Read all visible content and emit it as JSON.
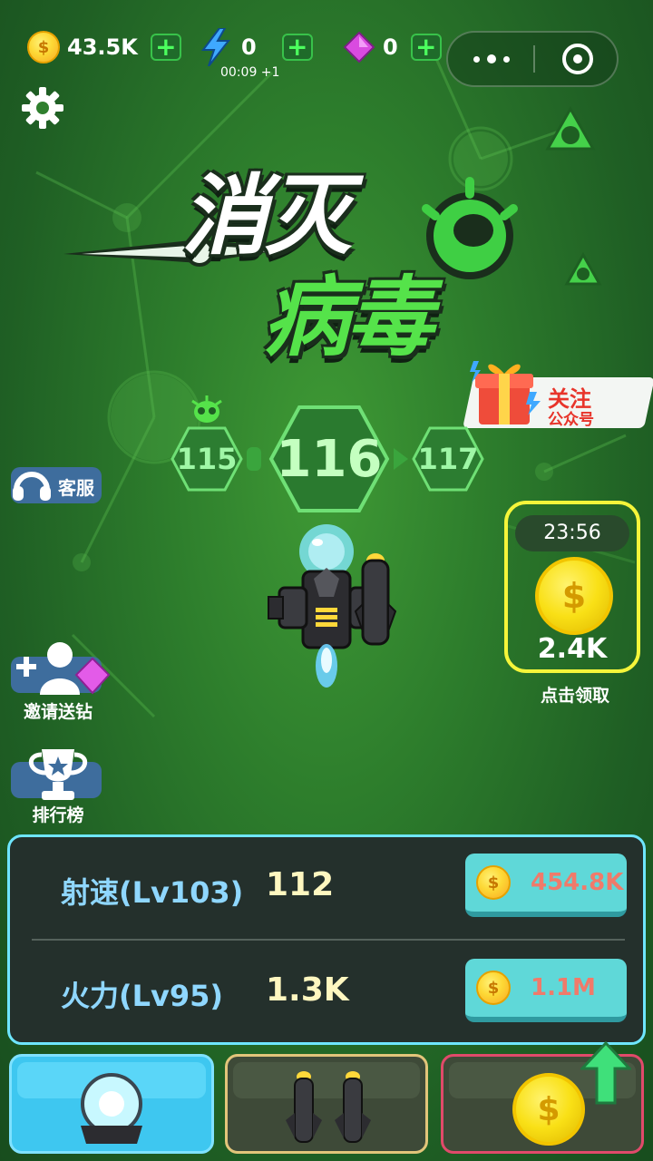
{
  "resources": {
    "gold": "43.5K",
    "energy": "0",
    "energy_timer": "00:09 +1",
    "gems": "0"
  },
  "title": {
    "line1": "消灭",
    "line2": "病毒"
  },
  "follow": {
    "line1": "关注",
    "line2": "公众号"
  },
  "levels": {
    "previous": "115",
    "current": "116",
    "next": "117"
  },
  "side_buttons": {
    "service": "客服",
    "invite": "邀请送钻",
    "ranking": "排行榜"
  },
  "reward": {
    "timer": "23:56",
    "amount": "2.4K",
    "label": "点击领取"
  },
  "upgrades": [
    {
      "label": "射速(Lv103)",
      "value": "112",
      "cost": "454.8K"
    },
    {
      "label": "火力(Lv95)",
      "value": "1.3K",
      "cost": "1.1M"
    }
  ],
  "colors": {
    "accent_green": "#55e34a",
    "panel_border": "#6ee6ff",
    "buy_button": "#5fd8d8",
    "cost_text": "#f07a6a",
    "reward_border": "#f5f53a"
  },
  "icons": {
    "settings": "gear-icon",
    "more": "more-icon",
    "close_miniprogram": "target-icon",
    "energy": "lightning-icon",
    "gem": "gem-icon",
    "coin": "coin-icon",
    "boss": "virus-skull-icon",
    "gift": "gift-icon",
    "headset": "headset-icon",
    "trophy": "trophy-icon"
  }
}
